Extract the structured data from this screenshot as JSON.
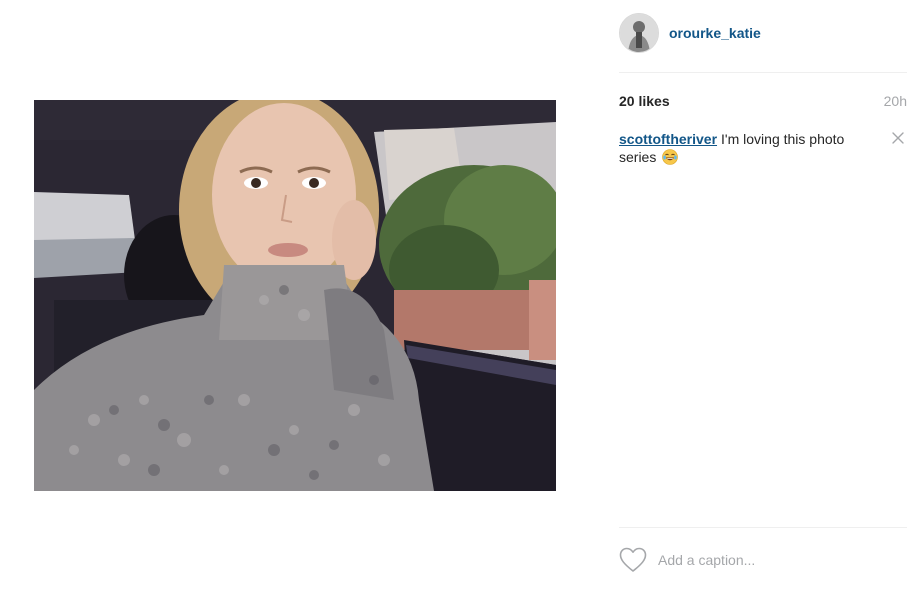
{
  "post": {
    "username": "orourke_katie",
    "likes_text": "20 likes",
    "time_ago": "20h"
  },
  "comments": [
    {
      "author": "scottoftheriver",
      "text": "I'm loving this photo series",
      "emoji": "tears-of-joy-emoji"
    }
  ],
  "composer": {
    "placeholder": "Add a caption..."
  },
  "colors": {
    "link": "#125688",
    "muted": "#a5a7aa",
    "divider": "#efefef"
  },
  "icons": {
    "like": "heart-outline-icon",
    "delete": "close-icon"
  }
}
